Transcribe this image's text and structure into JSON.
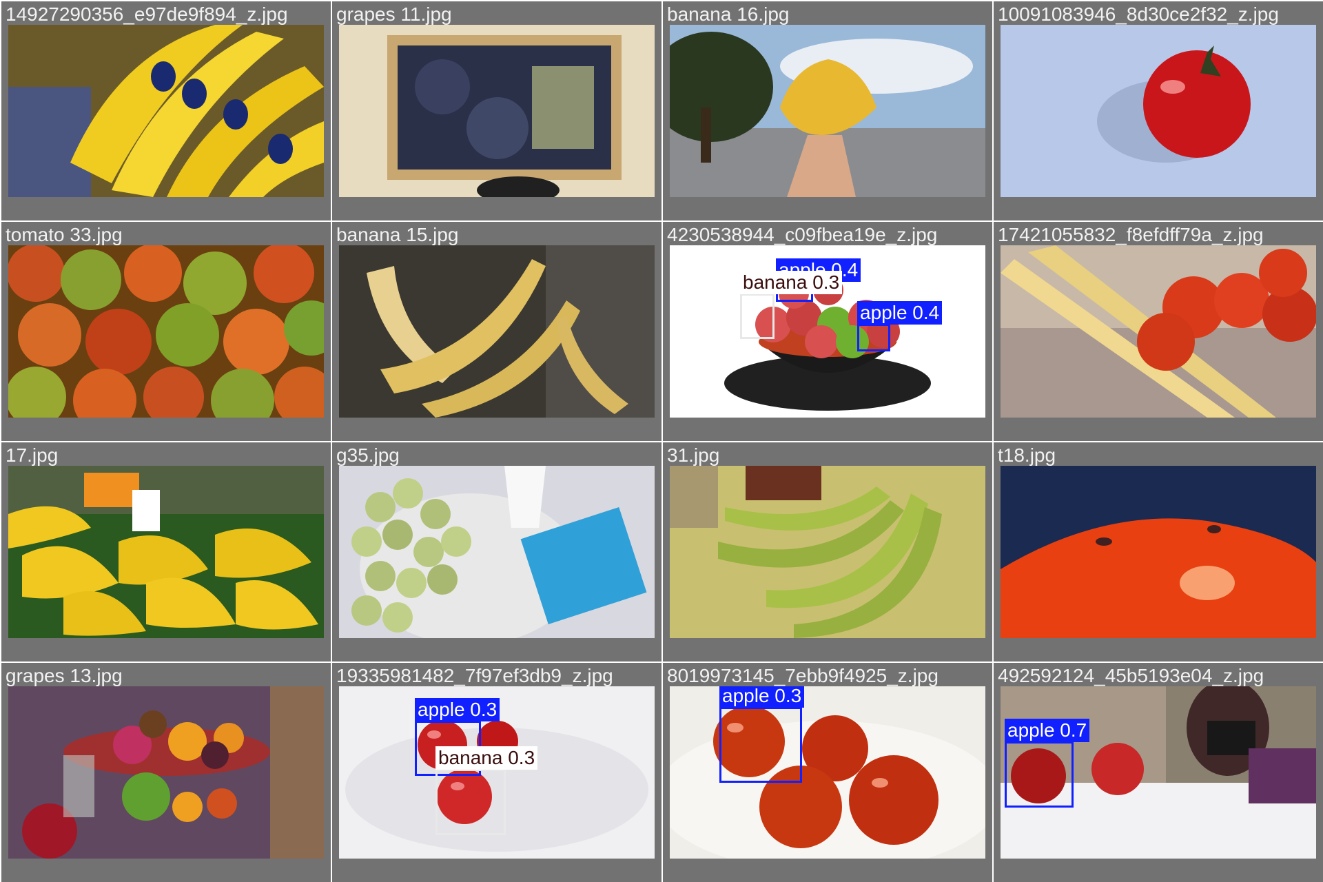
{
  "tiles": [
    {
      "filename": "14927290356_e97de9f894_z.jpg",
      "scene": "bananas",
      "detections": []
    },
    {
      "filename": "grapes 11.jpg",
      "scene": "grapes-crate",
      "detections": []
    },
    {
      "filename": "banana 16.jpg",
      "scene": "hand-bananas",
      "detections": []
    },
    {
      "filename": "10091083946_8d30ce2f32_z.jpg",
      "scene": "tomato-blue",
      "detections": []
    },
    {
      "filename": "tomato 33.jpg",
      "scene": "tomatoes-pile",
      "detections": []
    },
    {
      "filename": "banana 15.jpg",
      "scene": "ripe-bananas",
      "detections": []
    },
    {
      "filename": "4230538944_c09fbea19e_z.jpg",
      "scene": "apple-bowl",
      "detections": [
        {
          "class": "apple",
          "label": "apple 0.4"
        },
        {
          "class": "banana",
          "label": "banana 0.3"
        },
        {
          "class": "apple",
          "label": "apple 0.4"
        }
      ]
    },
    {
      "filename": "17421055832_f8efdff79a_z.jpg",
      "scene": "spaghetti-tomatoes",
      "detections": []
    },
    {
      "filename": "17.jpg",
      "scene": "market-bananas",
      "detections": []
    },
    {
      "filename": "g35.jpg",
      "scene": "green-grapes",
      "detections": []
    },
    {
      "filename": "31.jpg",
      "scene": "green-bananas",
      "detections": []
    },
    {
      "filename": "t18.jpg",
      "scene": "tomato-fly",
      "detections": []
    },
    {
      "filename": "grapes 13.jpg",
      "scene": "fruit-platter",
      "detections": []
    },
    {
      "filename": "19335981482_7f97ef3db9_z.jpg",
      "scene": "red-apples",
      "detections": [
        {
          "class": "apple",
          "label": "apple 0.3"
        },
        {
          "class": "banana",
          "label": "banana 0.3"
        }
      ]
    },
    {
      "filename": "8019973145_7ebb9f4925_z.jpg",
      "scene": "tomatoes-plate",
      "detections": [
        {
          "class": "apple",
          "label": "apple 0.3"
        }
      ]
    },
    {
      "filename": "492592124_45b5193e04_z.jpg",
      "scene": "photographer-apples",
      "detections": [
        {
          "class": "apple",
          "label": "apple 0.7"
        }
      ]
    }
  ],
  "colors": {
    "apple_box": "#1020ff",
    "banana_box": "#e8e8e8",
    "tile_border": "#727272"
  }
}
